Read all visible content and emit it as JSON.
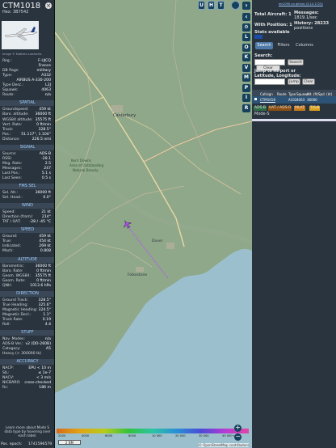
{
  "aircraft": {
    "callsign": "CTM1018",
    "hex": "Hex: 3B7542",
    "photo_credit": "Image © Mathieu Lamberts",
    "close": "×"
  },
  "details": [
    {
      "k": "Reg.:",
      "v": "F-UJCQ"
    },
    {
      "k": "",
      "v": "France"
    },
    {
      "k": "DB flags:",
      "v": "military"
    },
    {
      "k": "Type:",
      "v": "A332"
    },
    {
      "k": "",
      "v": "AIRBUS A-330-200"
    },
    {
      "k": "Type Desc.:",
      "v": "L2J"
    },
    {
      "k": "Squawk:",
      "v": "4063"
    },
    {
      "k": "Route:",
      "v": "n/a"
    }
  ],
  "sections": {
    "spatial": {
      "title": "SPATIAL",
      "rows": [
        {
          "k": "Groundspeed:",
          "v": "459 kt"
        },
        {
          "k": "Baro. altitude:",
          "v": "36000 ft"
        },
        {
          "k": "WGS84 altitude:",
          "v": "35575 ft"
        },
        {
          "k": "Vert. Rate:",
          "v": "0 ft/min"
        },
        {
          "k": "Track:",
          "v": "328.5°"
        },
        {
          "k": "Pos.:",
          "v": "51.117°, 1.104°"
        },
        {
          "k": "Distance:",
          "v": "226.5 nmi"
        }
      ]
    },
    "signal": {
      "title": "SIGNAL",
      "rows": [
        {
          "k": "Source:",
          "v": "ADS-B"
        },
        {
          "k": "RSSI:",
          "v": "-28.1"
        },
        {
          "k": "Msg. Rate:",
          "v": "2.5"
        },
        {
          "k": "Messages:",
          "v": "247"
        },
        {
          "k": "Last Pos.:",
          "v": "5.1 s"
        },
        {
          "k": "Last Seen:",
          "v": "0.5 s"
        }
      ]
    },
    "fms": {
      "title": "FMS SEL",
      "rows": [
        {
          "k": "Sel. Alt.:",
          "v": "36000 ft"
        },
        {
          "k": "Sel. Head.:",
          "v": "0.0°"
        }
      ]
    },
    "wind": {
      "title": "WIND",
      "rows": [
        {
          "k": "Speed:",
          "v": "21 kt"
        },
        {
          "k": "Direction (from):",
          "v": "214°"
        },
        {
          "k": "TAT / OAT:",
          "v": "-28 / -45 °C"
        }
      ]
    },
    "speed": {
      "title": "SPEED",
      "rows": [
        {
          "k": "Ground:",
          "v": "459 kt"
        },
        {
          "k": "True:",
          "v": "454 kt"
        },
        {
          "k": "Indicated:",
          "v": "269 kt"
        },
        {
          "k": "Mach:",
          "v": "0.808"
        }
      ]
    },
    "altitude": {
      "title": "ALTITUDE",
      "rows": [
        {
          "k": "Barometric:",
          "v": "36000 ft"
        },
        {
          "k": "Baro. Rate:",
          "v": "0 ft/min"
        },
        {
          "k": "Geom. WGS84:",
          "v": "35575 ft"
        },
        {
          "k": "Geom. Rate:",
          "v": "0 ft/min"
        },
        {
          "k": "QNH:",
          "v": "1013.6 hPa"
        }
      ]
    },
    "direction": {
      "title": "DIRECTION",
      "rows": [
        {
          "k": "Ground Track:",
          "v": "328.5°"
        },
        {
          "k": "True Heading:",
          "v": "325.6°"
        },
        {
          "k": "Magnetic Heading:",
          "v": "324.5°"
        },
        {
          "k": "Magnetic Decl.:",
          "v": "1.1°"
        },
        {
          "k": "Track Rate:",
          "v": "0.19"
        },
        {
          "k": "Roll:",
          "v": "4.4"
        }
      ]
    },
    "stuff": {
      "title": "STUFF",
      "rows": [
        {
          "k": "Nav. Modes:",
          "v": "n/a"
        },
        {
          "k": "ADS-B Ver.:",
          "v": "v2 (DO-260B)"
        },
        {
          "k": "Category:",
          "v": "A5"
        },
        {
          "k": "Heavy (> 300000 lb)",
          "v": ""
        }
      ]
    },
    "accuracy": {
      "title": "ACCURACY",
      "rows": [
        {
          "k": "NACP:",
          "v": "EPU < 10 m"
        },
        {
          "k": "SIL:",
          "v": "≤ 1e-7"
        },
        {
          "k": "NACV:",
          "v": "< 3 m/s"
        },
        {
          "k": "NICBARO:",
          "v": "cross-checked"
        },
        {
          "k": "Rc:",
          "v": "186 m"
        }
      ]
    }
  },
  "footer": {
    "learn": "Learn more about Mode S data type by hovering over each label.",
    "epoch_label": "Pos. epoch:",
    "epoch_value": "1741596579"
  },
  "map": {
    "top_buttons": [
      "U",
      "H",
      "T"
    ],
    "side_buttons": [
      "L",
      "O",
      "K",
      "V",
      "M",
      "P",
      "I",
      "R"
    ],
    "places": [
      "Canterbury",
      "Kent Downs",
      "Dover",
      "Folkestone",
      "Area of Outstanding",
      "Natural Beauty"
    ],
    "scale": "2 NM",
    "zoom_in": "+",
    "zoom_out": "−",
    "attribution": "© OpenStreetMap contributors",
    "legend": [
      "2000",
      "4000",
      "6000",
      "8000",
      "10 000",
      "20 000",
      "30 000",
      "40 000+"
    ]
  },
  "panel": {
    "link": "tar1090 on github (3.14.1725)",
    "total_label": "Total Aircraft: 1",
    "messages_label": "Messages:",
    "messages_value": "1819.1/sec",
    "with_pos": "With Position: 1",
    "history_label": "History: 28233",
    "history_value": "positions",
    "stats": "Stats available",
    "tabs": [
      "Search",
      "Filters",
      "Columns"
    ],
    "search_label": "Search:",
    "search_button": "Search",
    "clear_search": "Clear Search",
    "jump_label": "Jump to Airport or Latitude, Longitude:",
    "jump_button": "Jump",
    "clear_button": "Clear",
    "columns": [
      "Callsign",
      "Route",
      "Type",
      "Squawk",
      "Alt. (ft)",
      "Spd. (kt)"
    ],
    "row": [
      "CTM1018",
      "",
      "A332",
      "4063",
      "36000",
      ""
    ],
    "chips": [
      "ADS-B",
      "UAT / ADS-R",
      "MLAT",
      "TIS-B"
    ],
    "mode_s": "Mode-S"
  },
  "colors": {
    "panel": "#29343f",
    "accent": "#9fd0ff",
    "adsb": "#2e6a45",
    "uat": "#8a4f12",
    "mlat": "#c67a1c",
    "tisb": "#d9a21e",
    "map_land": "#8ea889",
    "map_sea": "#9bbfcc"
  }
}
